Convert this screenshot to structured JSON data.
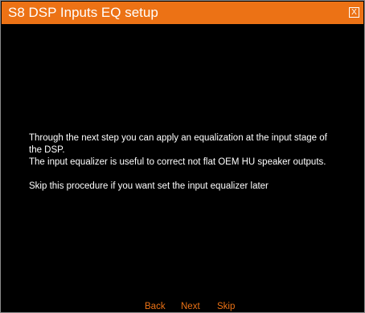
{
  "window": {
    "title": "S8 DSP Inputs EQ setup",
    "close_label": "X"
  },
  "content": {
    "line1": "Through the next step you can apply an equalization at the input stage of",
    "line2": "the DSP.",
    "line3": "The input equalizer is useful to correct not flat OEM HU speaker outputs.",
    "line4": "Skip this procedure if you want set the input equalizer later"
  },
  "nav": {
    "back_label": "Back",
    "next_label": "Next",
    "skip_label": "Skip"
  },
  "colors": {
    "accent": "#ec7215",
    "background": "#000000",
    "text": "#ffffff"
  }
}
